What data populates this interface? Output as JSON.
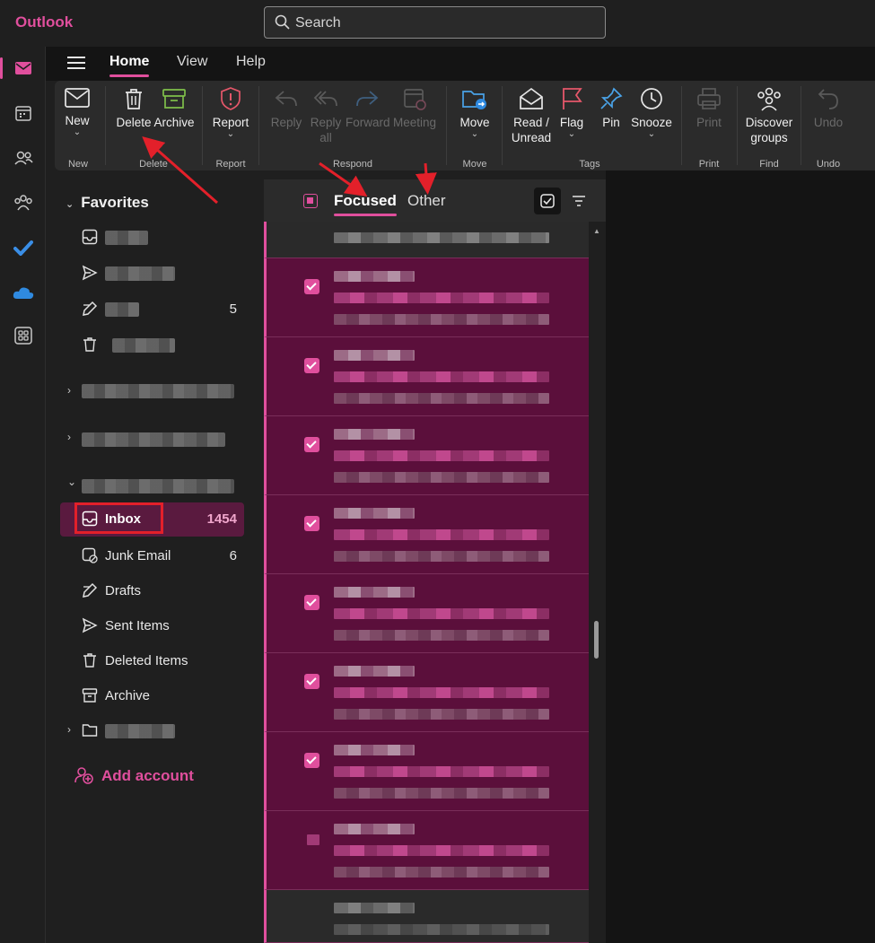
{
  "app": {
    "title": "Outlook"
  },
  "search": {
    "placeholder": "Search"
  },
  "tabs": [
    "Home",
    "View",
    "Help"
  ],
  "ribbon": {
    "new": {
      "label": "New",
      "group": "New"
    },
    "delete": {
      "label": "Delete",
      "group": "Delete"
    },
    "archive": {
      "label": "Archive"
    },
    "report": {
      "label": "Report",
      "group": "Report"
    },
    "reply": {
      "label": "Reply"
    },
    "reply_all": {
      "label1": "Reply",
      "label2": "all"
    },
    "forward": {
      "label": "Forward"
    },
    "meeting": {
      "label": "Meeting"
    },
    "respond_group": "Respond",
    "move": {
      "label": "Move",
      "group": "Move"
    },
    "read_unread": {
      "label1": "Read /",
      "label2": "Unread"
    },
    "flag": {
      "label": "Flag"
    },
    "pin": {
      "label": "Pin"
    },
    "snooze": {
      "label": "Snooze"
    },
    "tags_group": "Tags",
    "print": {
      "label": "Print",
      "group": "Print"
    },
    "discover": {
      "label1": "Discover",
      "label2": "groups",
      "group": "Find"
    },
    "undo": {
      "label": "Undo",
      "group": "Undo"
    }
  },
  "folders": {
    "favorites_label": "Favorites",
    "favorite_drafts_count": "5",
    "items": [
      {
        "label": "Inbox",
        "count": "1454"
      },
      {
        "label": "Junk Email",
        "count": "6"
      },
      {
        "label": "Drafts",
        "count": ""
      },
      {
        "label": "Sent Items",
        "count": ""
      },
      {
        "label": "Deleted Items",
        "count": ""
      },
      {
        "label": "Archive",
        "count": ""
      }
    ],
    "add_account": "Add account"
  },
  "message_list": {
    "tab_focused": "Focused",
    "tab_other": "Other"
  },
  "colors": {
    "accent": "#e04f9d",
    "selected_bg": "#5b0f3b",
    "annotation": "#e3202a"
  }
}
